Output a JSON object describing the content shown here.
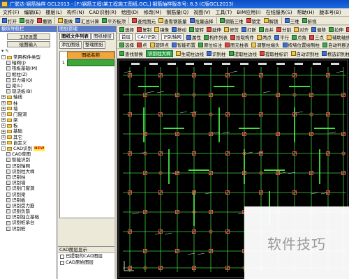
{
  "window": {
    "title": "广联达-钢筋抽样 GCL2013 - [F:\\钢筋工程\\某工程施工图纸.GCL] 钢筋抽样版本号: 8.3 (C版GCL2013)"
  },
  "menu": [
    "文件(F)",
    "编辑(E)",
    "楼层(L)",
    "构件(N)",
    "CAD识别(R)",
    "绘图(D)",
    "修改(M)",
    "钢筋量(Q)",
    "视图(V)",
    "工具(T)",
    "BIM应用(I)",
    "在线服务(S)",
    "帮助(H)",
    "版本号(B)"
  ],
  "toolbar1": [
    "打开",
    "保存",
    "撤销",
    "重做",
    "汇总计算",
    "平齐板顶",
    "查找图元",
    "查看钢筋量",
    "批量选择",
    "钢筋三维",
    "锁定",
    "解锁",
    "三维",
    "俯视"
  ],
  "left_panel": {
    "title": "模块导航栏",
    "buttons": [
      "工程设置",
      "绘图输入"
    ],
    "tree": [
      {
        "label": "常用构件类型",
        "type": "folder",
        "expand": "-",
        "indent": 0
      },
      {
        "label": "轴网(J)",
        "type": "leaf",
        "indent": 1
      },
      {
        "label": "筏板基础(M)",
        "type": "leaf",
        "indent": 1
      },
      {
        "label": "框柱(Z)",
        "type": "leaf",
        "indent": 1
      },
      {
        "label": "剪力墙(Q)",
        "type": "leaf",
        "indent": 1
      },
      {
        "label": "梁(L)",
        "type": "leaf",
        "indent": 1
      },
      {
        "label": "现浇板(B)",
        "type": "leaf",
        "indent": 1
      },
      {
        "label": "轴线",
        "type": "folder",
        "expand": "+",
        "indent": 0
      },
      {
        "label": "柱",
        "type": "folder",
        "expand": "+",
        "indent": 0
      },
      {
        "label": "墙",
        "type": "folder",
        "expand": "+",
        "indent": 0
      },
      {
        "label": "门窗洞",
        "type": "folder",
        "expand": "+",
        "indent": 0
      },
      {
        "label": "梁",
        "type": "folder",
        "expand": "+",
        "indent": 0
      },
      {
        "label": "板",
        "type": "folder",
        "expand": "+",
        "indent": 0
      },
      {
        "label": "基础",
        "type": "folder",
        "expand": "+",
        "indent": 0
      },
      {
        "label": "其它",
        "type": "folder",
        "expand": "+",
        "indent": 0
      },
      {
        "label": "自定义",
        "type": "folder",
        "expand": "+",
        "indent": 0
      },
      {
        "label": "CAD识别",
        "type": "folder",
        "expand": "-",
        "indent": 0,
        "badge": "NEW"
      },
      {
        "label": "CAD草图",
        "type": "leaf",
        "indent": 1
      },
      {
        "label": "智能识别",
        "type": "leaf",
        "indent": 1
      },
      {
        "label": "识别轴网",
        "type": "leaf",
        "indent": 1
      },
      {
        "label": "识别柱大样",
        "type": "leaf",
        "indent": 1
      },
      {
        "label": "识别柱",
        "type": "leaf",
        "indent": 1
      },
      {
        "label": "识别墙",
        "type": "leaf",
        "indent": 1
      },
      {
        "label": "识别门窗洞",
        "type": "leaf",
        "indent": 1
      },
      {
        "label": "识别梁",
        "type": "leaf",
        "indent": 1
      },
      {
        "label": "识别板",
        "type": "leaf",
        "indent": 1
      },
      {
        "label": "识别受力筋",
        "type": "leaf",
        "indent": 1
      },
      {
        "label": "识别负筋",
        "type": "leaf",
        "indent": 1
      },
      {
        "label": "识别独立基础",
        "type": "leaf",
        "indent": 1
      },
      {
        "label": "识别桩承台",
        "type": "leaf",
        "indent": 1
      },
      {
        "label": "识别桩",
        "type": "leaf",
        "indent": 1
      }
    ]
  },
  "mid_panel": {
    "title": "图纸管理",
    "tabs": [
      "图纸文件列表",
      "图纸楼层"
    ],
    "buttons": [
      "添加图纸",
      "整理图纸"
    ],
    "column_header": "图纸名称",
    "row_number": "1",
    "cad_display": {
      "title": "CAD图层显示",
      "layers": [
        "已提取的CAD图层",
        "CAD原始图层"
      ]
    }
  },
  "right_bars": {
    "bar1": [
      "选择",
      "复制",
      "镜像",
      "移动",
      "旋转",
      "延伸",
      "修剪",
      "打断",
      "合并",
      "分割",
      "对齐",
      "偏移",
      "拉伸",
      "设置夹点"
    ],
    "bar2": [
      "首层",
      "CAD识别",
      "识别轴网",
      "属性",
      "构件列表",
      "拾取构件",
      "两点",
      "平行",
      "点角",
      "三点",
      "辅助轴线",
      "删除辅助轴线"
    ],
    "bar3": [
      "选择",
      "点",
      "旋转点",
      "智能布置",
      "原位标注",
      "图元柱表",
      "调整柱端头",
      "按墙位置绘制柱",
      "自动判断边角柱",
      "查改标注"
    ],
    "bar4": [
      "查找替换",
      "识别柱大样",
      "生成柱边线",
      "识别柱",
      "提取柱边线",
      "提取柱标识",
      "自动识别柱",
      "框选识别柱",
      "点选识别柱"
    ],
    "bar5": [
      "提取钢筋",
      "识别钢筋",
      "删除",
      "检查校核",
      "设置CAD图层",
      "显示指定图层",
      "隐藏指定图层",
      "还原CAD图元"
    ]
  },
  "watermark": "软件技巧",
  "colors": {
    "canvas_bg": "#000000",
    "axis": "#3ad33a",
    "column": "#ff4d4d",
    "dim": "#e6e6e6",
    "hatch": "#e85a5a"
  }
}
